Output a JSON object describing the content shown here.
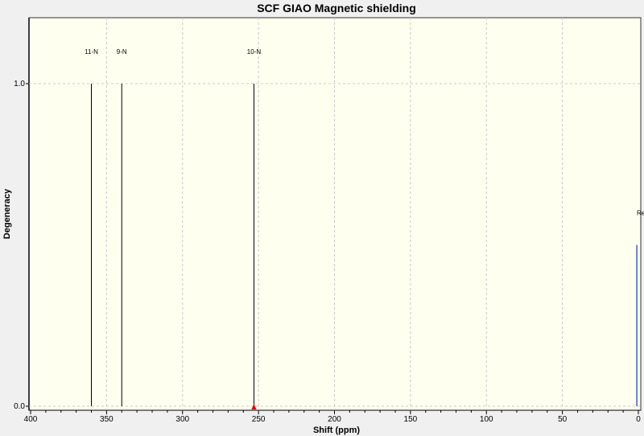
{
  "chart_data": {
    "type": "stick",
    "title": "SCF GIAO Magnetic shielding",
    "xlabel": "Shift (ppm)",
    "ylabel": "Degeneracy",
    "xlim": [
      400,
      0
    ],
    "ylim": [
      0.0,
      1.0
    ],
    "x_ticks": [
      400,
      350,
      300,
      250,
      200,
      150,
      100,
      50,
      0
    ],
    "y_ticks": [
      0.0,
      1.0
    ],
    "y_tick_labels": [
      "0.0",
      "1.0"
    ],
    "grid": true,
    "peaks": [
      {
        "label": "11-N",
        "x": 360,
        "y": 1.0
      },
      {
        "label": "9-N",
        "x": 340,
        "y": 1.0
      },
      {
        "label": "10-N",
        "x": 253,
        "y": 1.0
      }
    ],
    "reference": {
      "label": "Re",
      "x": 1,
      "y": 0.5,
      "color": "#3b5bdb"
    },
    "marker": {
      "x": 253,
      "color": "#e00000"
    },
    "colors": {
      "plot_bg": "#fffff0",
      "grid": "#c8c8c8",
      "stick": "#000000"
    }
  }
}
